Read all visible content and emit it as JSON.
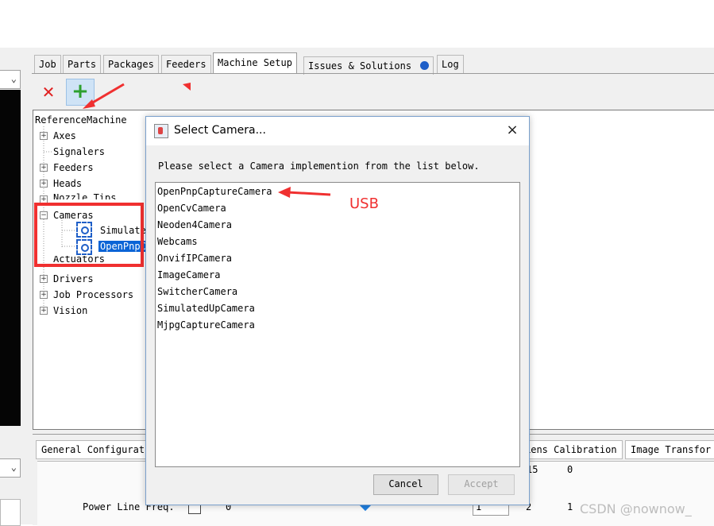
{
  "tabs": [
    {
      "label": "Job"
    },
    {
      "label": "Parts"
    },
    {
      "label": "Packages"
    },
    {
      "label": "Feeders"
    },
    {
      "label": "Machine Setup"
    },
    {
      "label": "Issues & Solutions"
    },
    {
      "label": "Log"
    }
  ],
  "toolbar": {
    "delete_icon": "✕",
    "add_icon": "+"
  },
  "tree": {
    "root": "ReferenceMachine",
    "items": [
      {
        "label": "Axes",
        "expandable": true
      },
      {
        "label": "Signalers",
        "expandable": false
      },
      {
        "label": "Feeders",
        "expandable": true
      },
      {
        "label": "Heads",
        "expandable": true
      },
      {
        "label": "Nozzle Tips",
        "expandable": true
      },
      {
        "label": "Cameras",
        "expandable": true,
        "expanded": true,
        "children": [
          {
            "label": "Simulate"
          },
          {
            "label": "OpenPnpC",
            "selected": true
          }
        ]
      },
      {
        "label": "Actuators",
        "expandable": true
      },
      {
        "label": "Drivers",
        "expandable": true
      },
      {
        "label": "Job Processors",
        "expandable": true
      },
      {
        "label": "Vision",
        "expandable": true
      }
    ]
  },
  "bottom": {
    "tabs": [
      {
        "label": "General Configurat"
      },
      {
        "label": "Lens Calibration"
      },
      {
        "label": "Image Transfor"
      }
    ],
    "power_line_label": "Power Line Freq.",
    "values": [
      "0",
      "15",
      "0",
      "1",
      "2",
      "1"
    ]
  },
  "dialog": {
    "title": "Select Camera...",
    "prompt": "Please select a Camera implemention from the list below.",
    "options": [
      "OpenPnpCaptureCamera",
      "OpenCvCamera",
      "Neoden4Camera",
      "Webcams",
      "OnvifIPCamera",
      "ImageCamera",
      "SwitcherCamera",
      "SimulatedUpCamera",
      "MjpgCaptureCamera"
    ],
    "cancel_label": "Cancel",
    "accept_label": "Accept",
    "close_icon": "×"
  },
  "annotations": {
    "usb_label": "USB",
    "arrow_color": "#f03030"
  },
  "watermark": "CSDN @nownow_",
  "colors": {
    "selection": "#0a64d6",
    "issues_dot": "#1f5fc8"
  }
}
